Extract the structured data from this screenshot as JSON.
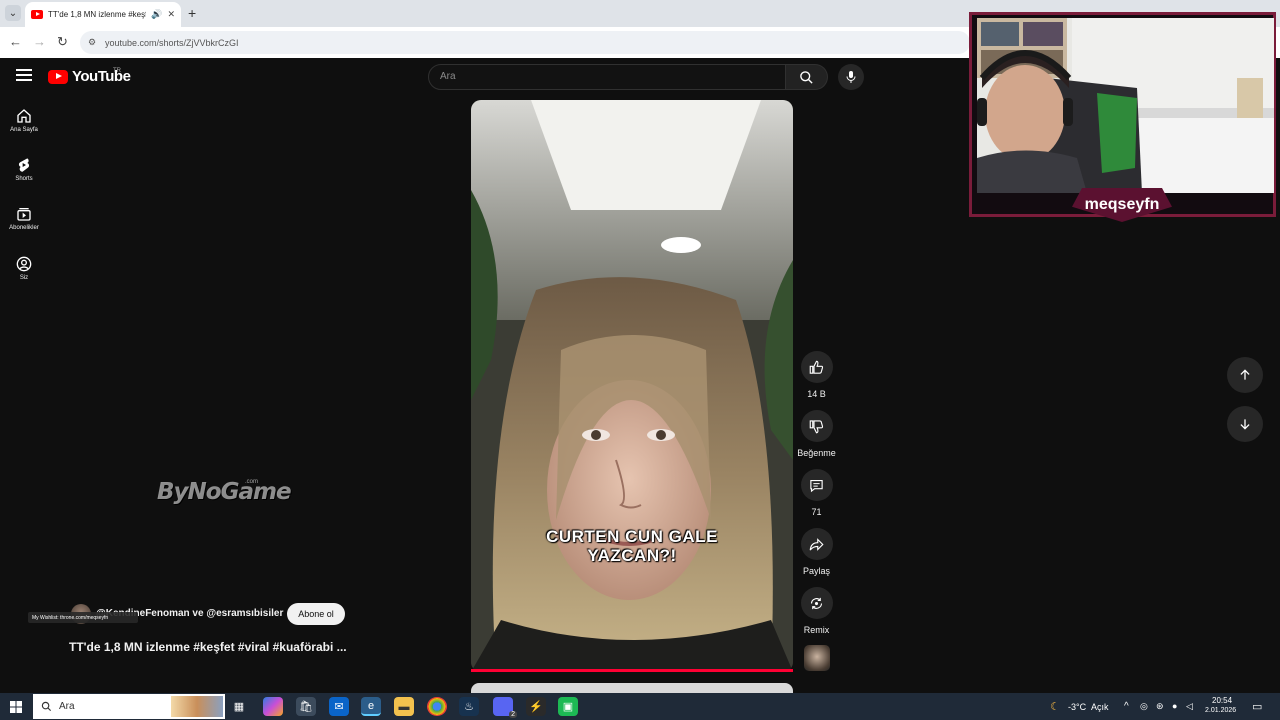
{
  "browser": {
    "tab_title": "TT'de 1,8 MN izlenme #keşfet",
    "url": "youtube.com/shorts/ZjVVbkrCzGI"
  },
  "youtube": {
    "logo": "YouTube",
    "country_code": "TR",
    "search_placeholder": "Ara",
    "guide": [
      {
        "label": "Ana Sayfa",
        "icon": "home-icon"
      },
      {
        "label": "Shorts",
        "icon": "shorts-icon"
      },
      {
        "label": "Abonelikler",
        "icon": "subscriptions-icon"
      },
      {
        "label": "Siz",
        "icon": "you-icon"
      }
    ]
  },
  "watermark": {
    "text": "ByNoGame",
    "sup": ".com"
  },
  "short": {
    "caption_line1": "CURTEN CUN GALE",
    "caption_line2": "YAZCAN?!",
    "channel": "@KendineFenoman ve @esramsıbisiler",
    "subscribe_label": "Abone ol",
    "wishlist_text": "My Wishlist: throne.com/meqseyfn",
    "title": "TT'de 1,8 MN izlenme #keşfet #viral #kuaförabi ...",
    "actions": {
      "like_count": "14 B",
      "dislike_label": "Beğenme",
      "comment_count": "71",
      "share_label": "Paylaş",
      "remix_label": "Remix"
    },
    "progress": 1.0
  },
  "webcam": {
    "streamer_name": "meqseyfn"
  },
  "taskbar": {
    "search_placeholder": "Ara",
    "weather_temp": "-3°C",
    "weather_desc": "Açık",
    "time": "20:54",
    "date": "2.01.2026",
    "pinned_badge": "2"
  },
  "colors": {
    "youtube_red": "#ff0000",
    "progress_red": "#ff0033",
    "webcam_border": "#7a1c3a"
  }
}
